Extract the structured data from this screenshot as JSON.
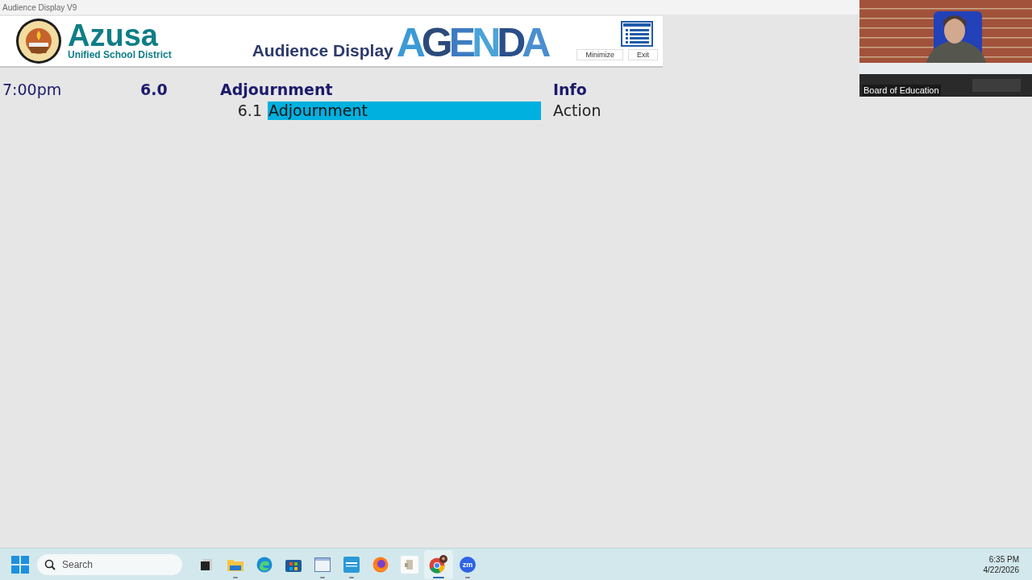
{
  "window": {
    "title": "Audience Display V9"
  },
  "header": {
    "district_name": "Azusa",
    "district_subtitle": "Unified School District",
    "display_title": "Audience Display",
    "logo_text": "AGENDA",
    "buttons": [
      "Minimize",
      "Exit"
    ]
  },
  "agenda": {
    "items": [
      {
        "time": "7:00pm",
        "number": "6.0",
        "title": "Adjournment",
        "type": "Info",
        "children": [
          {
            "number": "6.1",
            "title": "Adjournment",
            "type": "Action",
            "selected": true
          }
        ]
      }
    ]
  },
  "video": {
    "kind": "picture",
    "participant": "Board of Education"
  },
  "taskbar": {
    "search_placeholder": "Search",
    "time": "6:35 PM",
    "date": "4/22/2026",
    "apps": [
      {
        "kind": "taskview",
        "running": false,
        "selected": false
      },
      {
        "kind": "folder",
        "running": true,
        "selected": false
      },
      {
        "kind": "edge",
        "running": false,
        "selected": false
      },
      {
        "kind": "store",
        "running": false,
        "selected": false
      },
      {
        "kind": "window",
        "running": true,
        "selected": false
      },
      {
        "kind": "label",
        "running": true,
        "selected": false
      },
      {
        "kind": "firefox",
        "running": false,
        "selected": false
      },
      {
        "kind": "app",
        "running": false,
        "selected": false
      },
      {
        "kind": "chrome",
        "running": true,
        "selected": true
      },
      {
        "kind": "zoom",
        "label": "zm",
        "running": true,
        "selected": false
      }
    ]
  }
}
